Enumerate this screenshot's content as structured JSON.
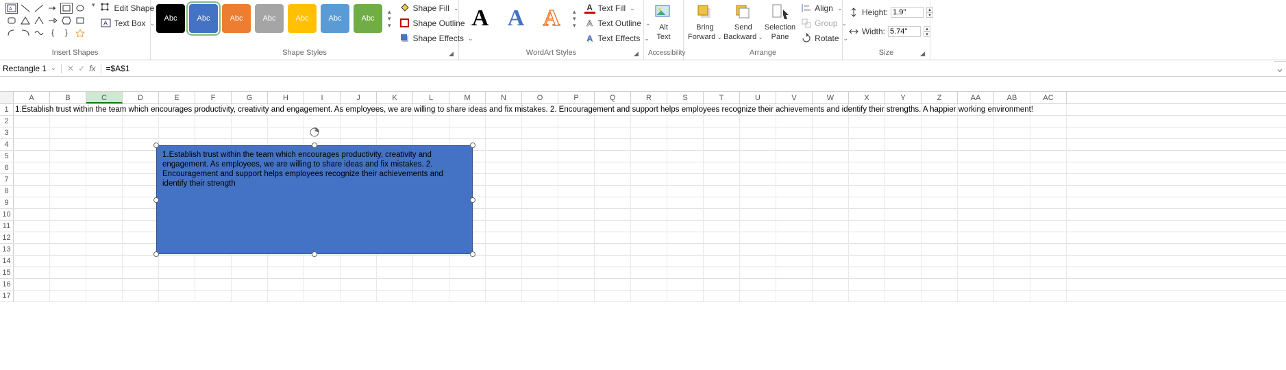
{
  "ribbon": {
    "insert_shapes": {
      "label": "Insert Shapes",
      "edit_shape": "Edit Shape",
      "text_box": "Text Box"
    },
    "shape_styles": {
      "label": "Shape Styles",
      "swatches": [
        {
          "bg": "#000000",
          "txt": "Abc",
          "sel": false
        },
        {
          "bg": "#4472C4",
          "txt": "Abc",
          "sel": true
        },
        {
          "bg": "#ED7D31",
          "txt": "Abc",
          "sel": false
        },
        {
          "bg": "#A5A5A5",
          "txt": "Abc",
          "sel": false
        },
        {
          "bg": "#FFC000",
          "txt": "Abc",
          "sel": false
        },
        {
          "bg": "#5B9BD5",
          "txt": "Abc",
          "sel": false
        },
        {
          "bg": "#70AD47",
          "txt": "Abc",
          "sel": false
        }
      ],
      "fill": "Shape Fill",
      "outline": "Shape Outline",
      "effects": "Shape Effects"
    },
    "wordart": {
      "label": "WordArt Styles",
      "items": [
        "A",
        "A",
        "A"
      ],
      "text_fill": "Text Fill",
      "text_outline": "Text Outline",
      "text_effects": "Text Effects"
    },
    "accessibility": {
      "label": "Accessibility",
      "alt_text_1": "Alt",
      "alt_text_2": "Text"
    },
    "arrange": {
      "label": "Arrange",
      "bring_1": "Bring",
      "bring_2": "Forward",
      "send_1": "Send",
      "send_2": "Backward",
      "sel_1": "Selection",
      "sel_2": "Pane",
      "align": "Align",
      "group": "Group",
      "rotate": "Rotate"
    },
    "size": {
      "label": "Size",
      "height_label": "Height:",
      "height_val": "1.9\"",
      "width_label": "Width:",
      "width_val": "5.74\""
    }
  },
  "formula_bar": {
    "name": "Rectangle 1",
    "formula": "=$A$1"
  },
  "columns": [
    "A",
    "B",
    "C",
    "D",
    "E",
    "F",
    "G",
    "H",
    "I",
    "J",
    "K",
    "L",
    "M",
    "N",
    "O",
    "P",
    "Q",
    "R",
    "S",
    "T",
    "U",
    "V",
    "W",
    "X",
    "Y",
    "Z",
    "AA",
    "AB",
    "AC"
  ],
  "selected_col": "C",
  "rows": [
    1,
    2,
    3,
    4,
    5,
    6,
    7,
    8,
    9,
    10,
    11,
    12,
    13,
    14,
    15,
    16,
    17
  ],
  "cell_a1": "1.Establish trust within the team which encourages productivity, creativity and engagement. As employees, we are willing to share ideas and fix mistakes. 2. Encouragement and support helps employees recognize their achievements and identify their strengths. A happier working environment!",
  "shape_text": "1.Establish trust within the team which encourages productivity, creativity and engagement. As employees, we are willing to share ideas and fix mistakes. 2. Encouragement and support helps employees recognize their achievements and identify their strength"
}
